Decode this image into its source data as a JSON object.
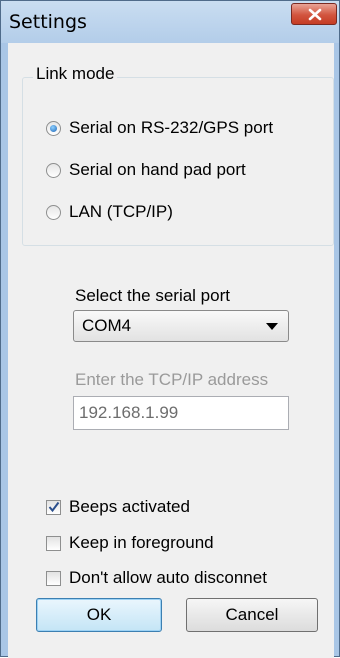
{
  "window": {
    "title": "Settings"
  },
  "link_mode": {
    "legend": "Link mode",
    "options": [
      {
        "label": "Serial on RS-232/GPS port",
        "selected": true
      },
      {
        "label": "Serial on hand pad port",
        "selected": false
      },
      {
        "label": "LAN (TCP/IP)",
        "selected": false
      }
    ]
  },
  "serial_port": {
    "label": "Select the serial port",
    "value": "COM4"
  },
  "tcp": {
    "label": "Enter the TCP/IP address",
    "value": "192.168.1.99"
  },
  "options": [
    {
      "label": "Beeps activated",
      "checked": true
    },
    {
      "label": "Keep in foreground",
      "checked": false
    },
    {
      "label": "Don't allow auto disconnet",
      "checked": false
    }
  ],
  "buttons": {
    "ok": "OK",
    "cancel": "Cancel"
  },
  "colors": {
    "accent": "#1b64b6",
    "close": "#c53c24",
    "frame": "#a9c6e6"
  }
}
